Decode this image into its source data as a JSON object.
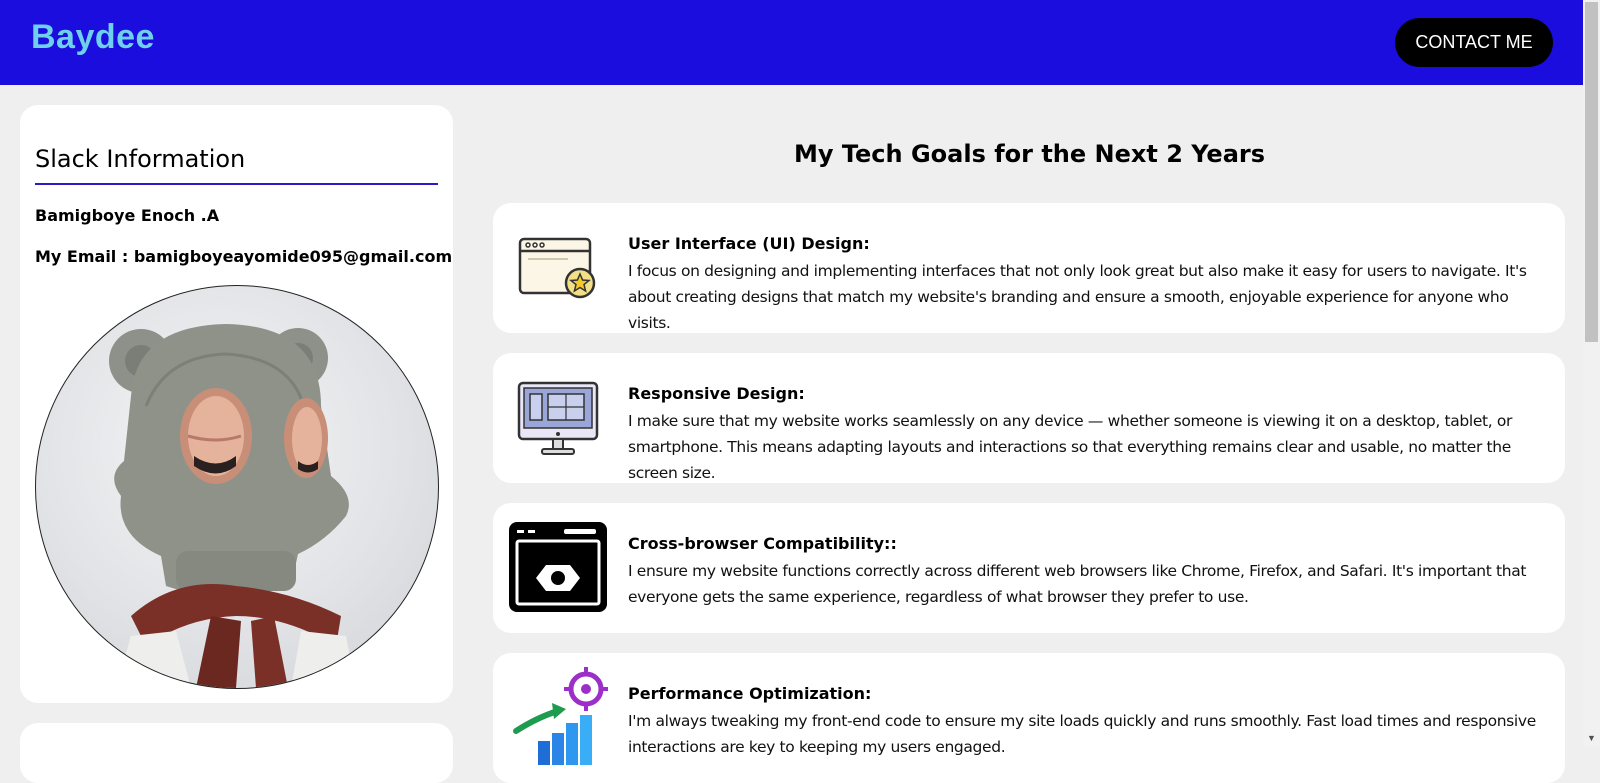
{
  "header": {
    "logo": "Baydee",
    "contact_label": "CONTACT ME"
  },
  "slack": {
    "title": "Slack Information",
    "name": "Bamigboye Enoch .A",
    "email": "My Email : bamigboyeayomide095@gmail.com"
  },
  "goals": {
    "title": "My Tech Goals for the Next 2 Years",
    "items": [
      {
        "heading": "User Interface (UI) Design:",
        "text": "I focus on designing and implementing interfaces that not only look great but also make it easy for users to navigate. It's about creating designs that match my website's branding and ensure a smooth, enjoyable experience for anyone who visits.",
        "icon": "browser-star-icon"
      },
      {
        "heading": "Responsive Design:",
        "text": "I make sure that my website works seamlessly on any device — whether someone is viewing it on a desktop, tablet, or smartphone. This means adapting layouts and interactions so that everything remains clear and usable, no matter the screen size.",
        "icon": "monitor-devices-icon"
      },
      {
        "heading": "Cross-browser Compatibility::",
        "text": "I ensure my website functions correctly across different web browsers like Chrome, Firefox, and Safari. It's important that everyone gets the same experience, regardless of what browser they prefer to use.",
        "icon": "browser-settings-icon"
      },
      {
        "heading": "Performance Optimization:",
        "text": "I'm always tweaking my front-end code to ensure my site loads quickly and runs smoothly. Fast load times and responsive interactions are key to keeping my users engaged.",
        "icon": "growth-target-icon"
      }
    ]
  },
  "colors": {
    "header_bg": "#1a0ddd",
    "logo": "#6fd0ee",
    "accent_rule": "#2a1bc9",
    "page_bg": "#efefef"
  }
}
